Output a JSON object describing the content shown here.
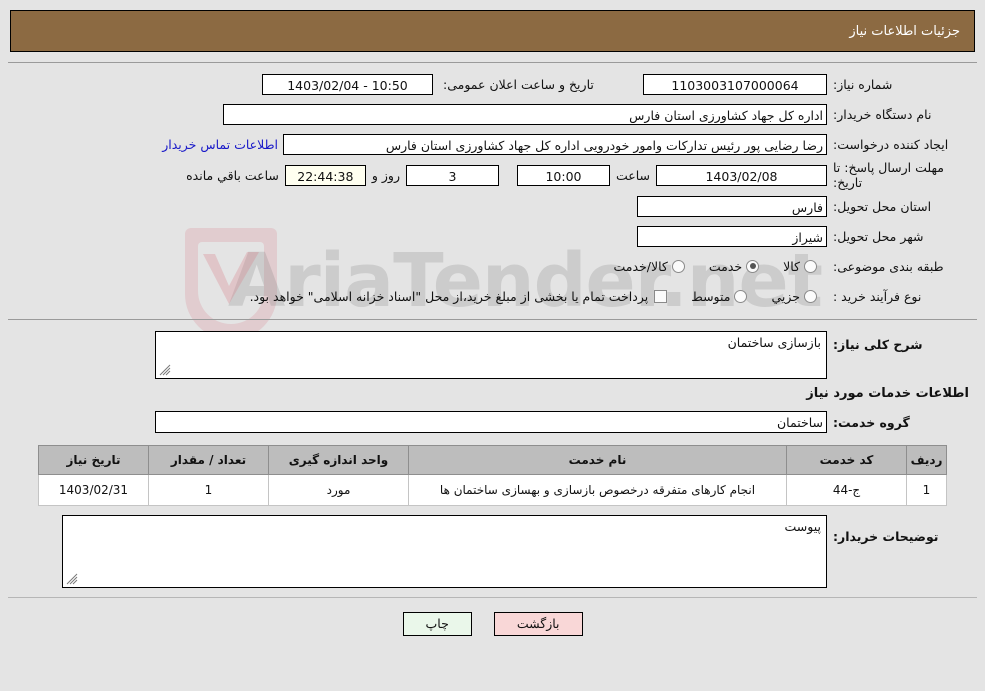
{
  "header": {
    "title": "جزئیات اطلاعات نیاز"
  },
  "colors": {
    "header_bg": "#8c6a42",
    "page_bg": "#e4e4e4",
    "link": "#1818c8",
    "timer_bg": "#fffff0",
    "print_btn_bg": "#eaf7ea",
    "back_btn_bg": "#f9d7d7",
    "table_header_bg": "#bdbdbd"
  },
  "form": {
    "need_number_label": "شماره نیاز:",
    "need_number_value": "1103003107000064",
    "public_announce_label": "تاریخ و ساعت اعلان عمومی:",
    "public_announce_value": "10:50 - 1403/02/04",
    "buyer_org_label": "نام دستگاه خریدار:",
    "buyer_org_value": "اداره کل جهاد کشاورزی استان فارس",
    "requester_label": "ایجاد کننده درخواست:",
    "requester_value": "رضا رضایی پور رئیس تدارکات وامور خودرویی اداره کل جهاد کشاورزی استان فارس",
    "buyer_contact_link": "اطلاعات تماس خریدار",
    "deadline_label": "مهلت ارسال پاسخ: تا تاریخ:",
    "deadline_date": "1403/02/08",
    "deadline_time_label": "ساعت",
    "deadline_time": "10:00",
    "remaining_days": "3",
    "remaining_days_label": "روز و",
    "remaining_timer": "22:44:38",
    "remaining_suffix": "ساعت باقي مانده",
    "province_label": "استان محل تحویل:",
    "province_value": "فارس",
    "city_label": "شهر محل تحویل:",
    "city_value": "شیراز",
    "classification_label": "طبقه بندی موضوعی:",
    "classification_options": [
      {
        "label": "کالا",
        "selected": false
      },
      {
        "label": "خدمت",
        "selected": true
      },
      {
        "label": "کالا/خدمت",
        "selected": false
      }
    ],
    "process_type_label": "نوع فرآیند خرید :",
    "process_type_options": [
      {
        "label": "جزیي",
        "selected": false
      },
      {
        "label": "متوسط",
        "selected": false
      }
    ],
    "treasury_checkbox_label": "پرداخت تمام یا بخشی از مبلغ خرید،از محل \"اسناد خزانه اسلامی\" خواهد بود.",
    "treasury_checked": false
  },
  "description": {
    "general_label": "شرح کلی نیاز:",
    "general_value": "بازسازی ساختمان",
    "services_section_title": "اطلاعات خدمات مورد نیاز",
    "service_group_label": "گروه خدمت:",
    "service_group_value": "ساختمان"
  },
  "table": {
    "columns": [
      "ردیف",
      "کد خدمت",
      "نام خدمت",
      "واحد اندازه گیری",
      "تعداد / مقدار",
      "تاریخ نیاز"
    ],
    "rows": [
      {
        "row_no": "1",
        "service_code": "ج-44",
        "service_name": "انجام کارهای متفرقه درخصوص بازسازی و بهسازی ساختمان ها",
        "unit": "مورد",
        "quantity": "1",
        "need_date": "1403/02/31"
      }
    ]
  },
  "buyer_notes": {
    "label": "توضیحات خریدار:",
    "value": "پیوست"
  },
  "footer": {
    "print_label": "چاپ",
    "back_label": "بازگشت"
  },
  "watermark": {
    "text": "AriaTender.net"
  }
}
